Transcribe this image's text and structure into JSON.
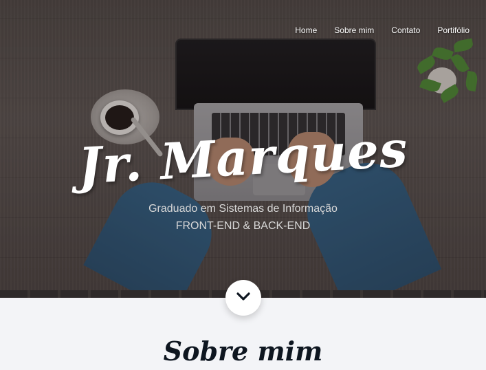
{
  "nav": {
    "items": [
      "Home",
      "Sobre mim",
      "Contato",
      "Portifólio"
    ]
  },
  "hero": {
    "title": "Jr. Marques",
    "subtitle_line1": "Graduado em Sistemas de Informação",
    "subtitle_line2": "FRONT-END & BACK-END",
    "scroll_icon": "chevron-down-icon"
  },
  "about": {
    "title": "Sobre mim"
  },
  "colors": {
    "page_background": "#f3f4f7",
    "title_text": "#ffffff",
    "section_title": "#0e1620",
    "scroll_button": "#ffffff",
    "chevron": "#0e1620"
  }
}
